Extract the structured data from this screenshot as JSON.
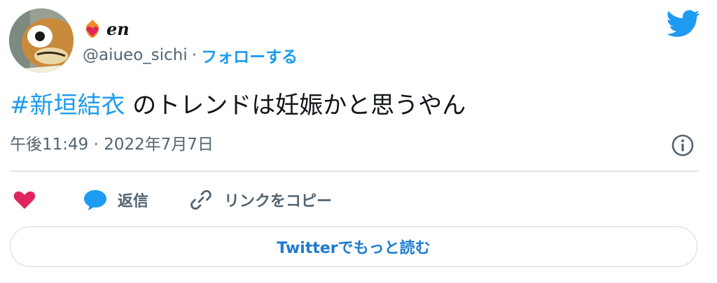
{
  "author": {
    "display_name": "en",
    "handle": "@aiueo_sichi",
    "separator": "·",
    "follow_label": "フォローする"
  },
  "tweet": {
    "hashtag": "#新垣結衣",
    "text": " のトレンドは妊娠かと思うやん",
    "timestamp": "午後11:49 · 2022年7月7日"
  },
  "actions": {
    "reply_label": "返信",
    "copy_link_label": "リンクをコピー"
  },
  "footer": {
    "read_more_label": "Twitterでもっと読む"
  },
  "colors": {
    "twitter_blue": "#1d9bf0",
    "like_pink": "#e0245e",
    "muted_gray": "#536471"
  },
  "icons": [
    "fire-heart-icon",
    "twitter-bird-icon",
    "info-icon",
    "heart-icon",
    "reply-bubble-icon",
    "link-icon"
  ]
}
